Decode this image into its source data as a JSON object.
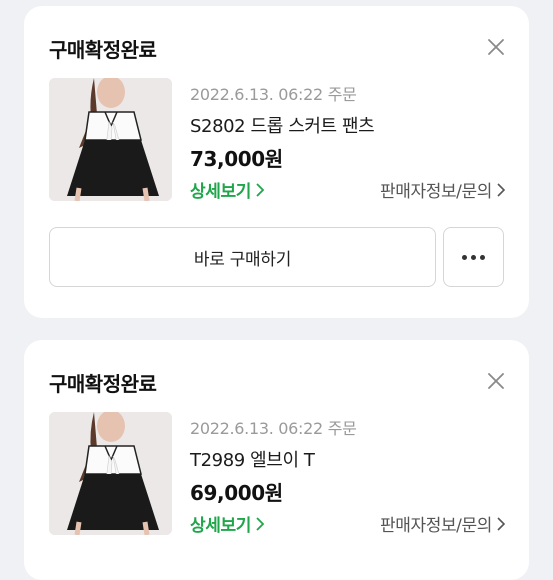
{
  "orders": [
    {
      "status": "구매확정완료",
      "date": "2022.6.13. 06:22 주문",
      "product": "S2802 드롭 스커트 팬츠",
      "price": "73,000원",
      "detail_label": "상세보기",
      "seller_label": "판매자정보/문의",
      "buy_again_label": "바로 구매하기"
    },
    {
      "status": "구매확정완료",
      "date": "2022.6.13. 06:22 주문",
      "product": "T2989 엘브이 T",
      "price": "69,000원",
      "detail_label": "상세보기",
      "seller_label": "판매자정보/문의"
    }
  ],
  "colors": {
    "accent_green": "#1fa64a",
    "background": "#f0f1f5",
    "card": "#ffffff"
  },
  "icons": [
    "close-icon",
    "chevron-right-icon",
    "more-dots-icon"
  ]
}
